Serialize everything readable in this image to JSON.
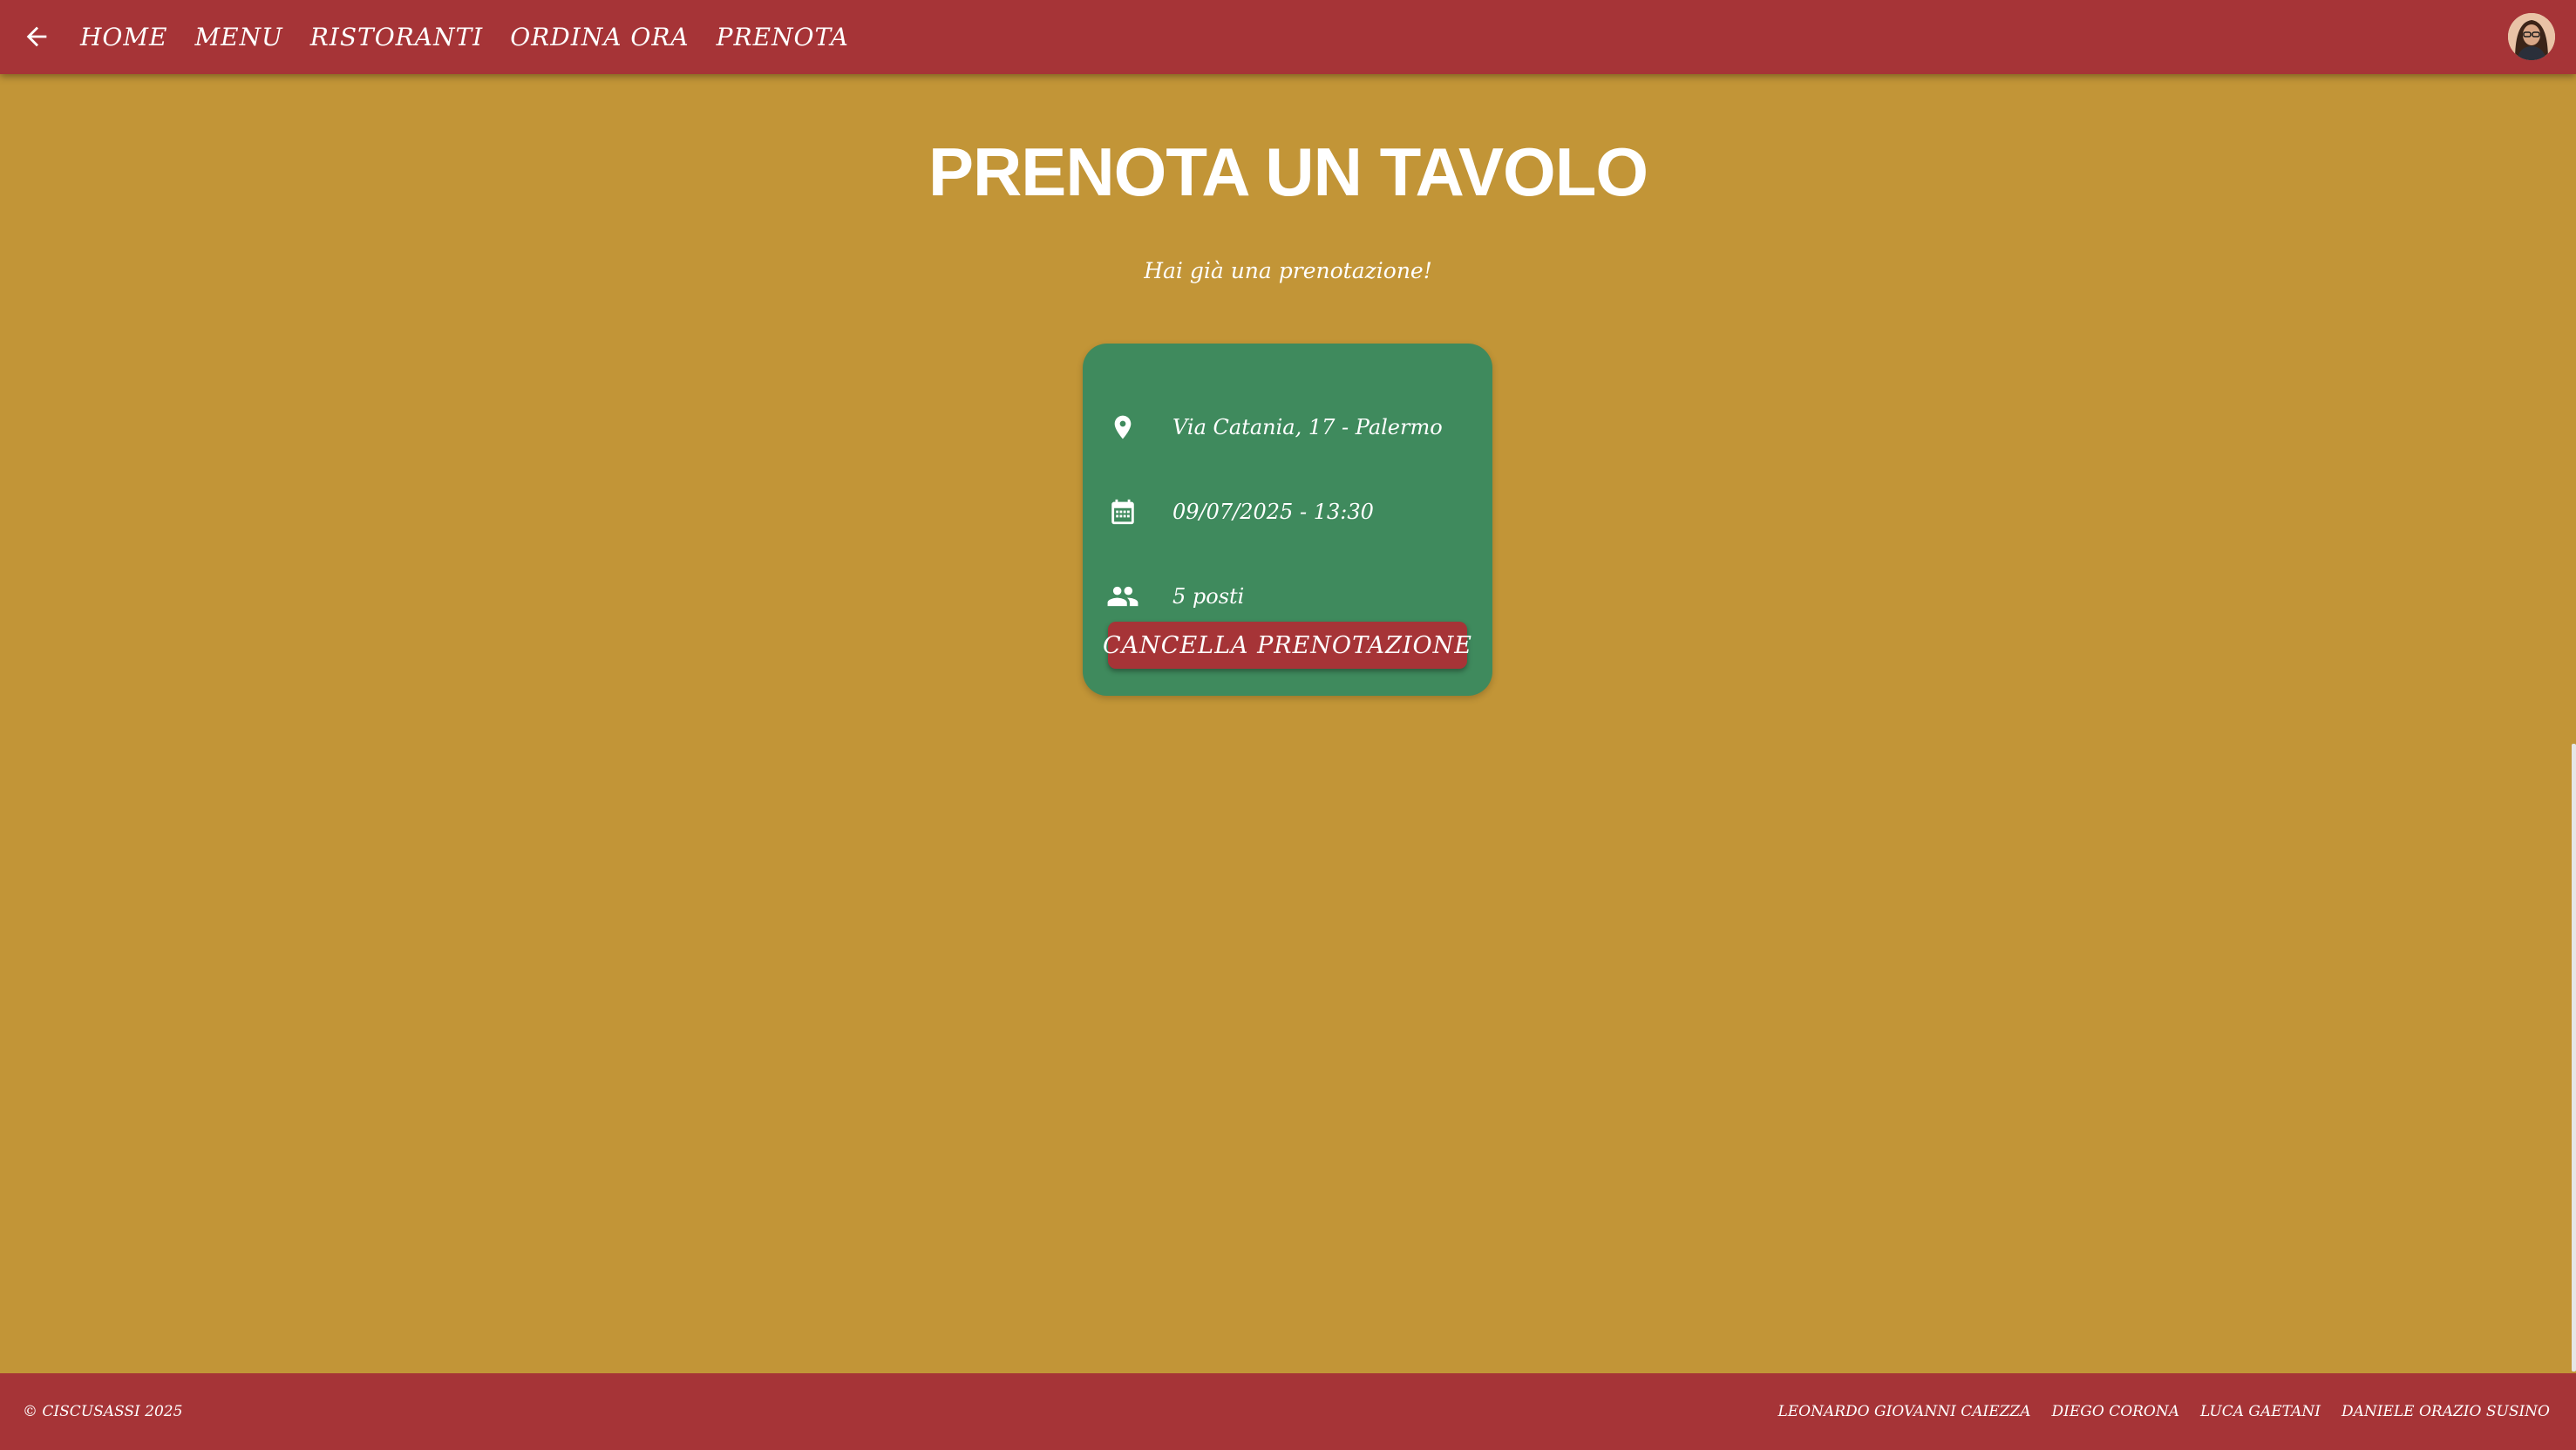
{
  "nav": {
    "items": [
      {
        "label": "HOME"
      },
      {
        "label": "MENU"
      },
      {
        "label": "RISTORANTI"
      },
      {
        "label": "ORDINA ORA"
      },
      {
        "label": "PRENOTA"
      }
    ],
    "back_icon": "arrow-back-icon",
    "avatar_icon": "user-avatar"
  },
  "main": {
    "title": "PRENOTA UN TAVOLO",
    "subtitle": "Hai già una prenotazione!"
  },
  "reservation": {
    "address": "Via Catania, 17 - Palermo",
    "datetime": "09/07/2025 - 13:30",
    "seats": "5 posti",
    "icons": [
      "location-pin-icon",
      "calendar-icon",
      "people-icon"
    ],
    "cancel_label": "CANCELLA PRENOTAZIONE"
  },
  "footer": {
    "copyright": "© CISCUSASSI 2025",
    "authors": [
      {
        "name": "LEONARDO GIOVANNI CAIEZZA"
      },
      {
        "name": "DIEGO CORONA"
      },
      {
        "name": "LUCA GAETANI"
      },
      {
        "name": "DANIELE ORAZIO SUSINO"
      }
    ]
  },
  "colors": {
    "background": "#c29537",
    "bar": "#a63437",
    "card": "#3f8a5d",
    "text": "#ffffff"
  }
}
